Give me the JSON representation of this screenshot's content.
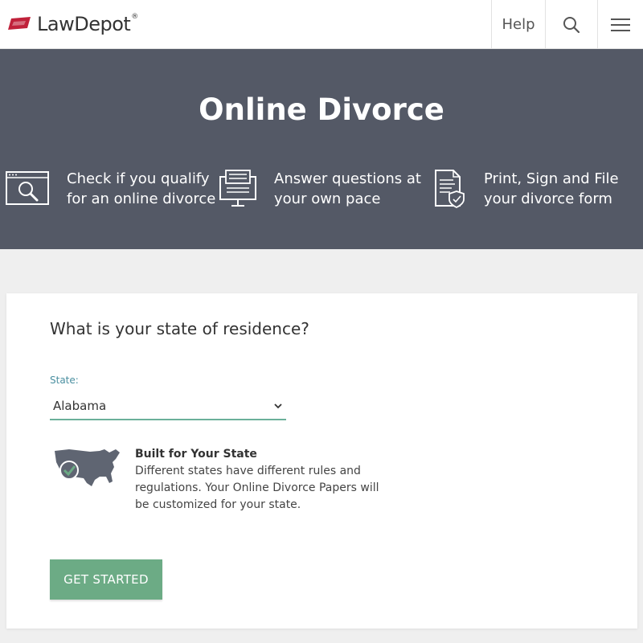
{
  "header": {
    "brand": "LawDepot",
    "brand_reg": "®",
    "help_label": "Help",
    "search_icon": "search-icon",
    "menu_icon": "hamburger-menu-icon"
  },
  "hero": {
    "title": "Online Divorce",
    "features": [
      {
        "icon": "magnifier-browser-icon",
        "text": "Check if you qualify for an online divorce"
      },
      {
        "icon": "monitor-form-icon",
        "text": "Answer questions at your own pace"
      },
      {
        "icon": "document-shield-icon",
        "text": "Print, Sign and File your divorce form"
      }
    ]
  },
  "form": {
    "question": "What is your state of residence?",
    "state_label": "State:",
    "state_value": "Alabama",
    "info_icon": "usa-map-check-icon",
    "info_title": "Built for Your State",
    "info_body": "Different states have different rules and regulations. Your Online Divorce Papers will be customized for your state.",
    "cta_label": "GET STARTED"
  },
  "colors": {
    "brand_red": "#c0213a",
    "hero_bg": "#545966",
    "cta_green": "#6cab85",
    "select_underline": "#6bb09a",
    "label_teal": "#4a8fa0"
  }
}
